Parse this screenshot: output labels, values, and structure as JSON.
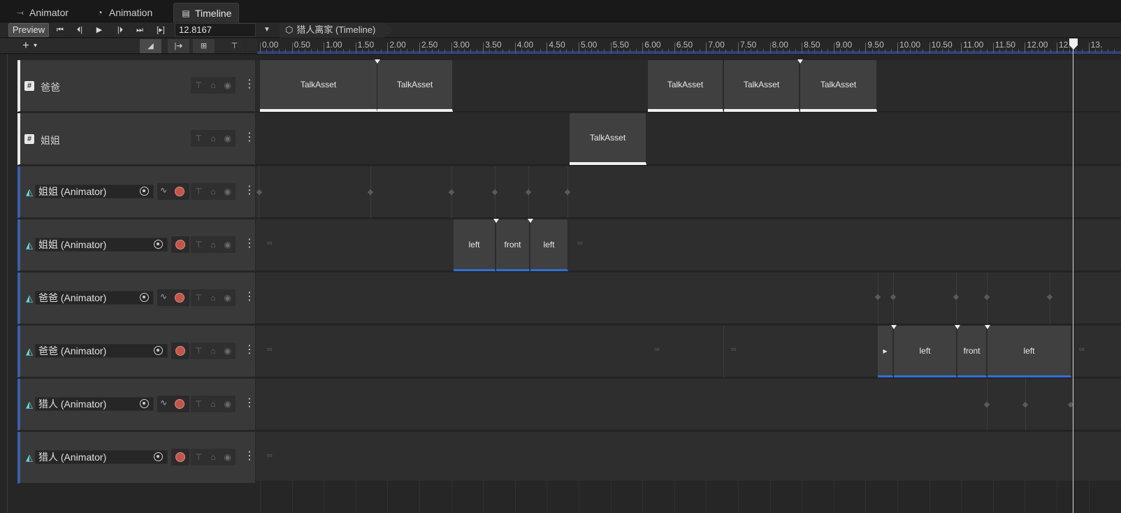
{
  "tabs": [
    {
      "label": "Animator",
      "icon": "animator-icon"
    },
    {
      "label": "Animation",
      "icon": "clock-icon"
    },
    {
      "label": "Timeline",
      "icon": "film-icon"
    }
  ],
  "toolbar": {
    "preview_label": "Preview",
    "time_value": "12.8167",
    "timeline_asset": "猎人离家 (Timeline)"
  },
  "ruler": {
    "labels": [
      "0.00",
      "0.50",
      "1.00",
      "1.50",
      "2.00",
      "2.50",
      "3.00",
      "3.50",
      "4.00",
      "4.50",
      "5.00",
      "5.50",
      "6.00",
      "6.50",
      "7.00",
      "7.50",
      "8.00",
      "8.50",
      "9.00",
      "9.50",
      "10.00",
      "10.50",
      "11.00",
      "11.50",
      "12.00",
      "12.5",
      "13."
    ]
  },
  "tracks": [
    {
      "type": "signal",
      "name": "爸爸"
    },
    {
      "type": "signal",
      "name": "姐姐"
    },
    {
      "type": "animator",
      "name": "姐姐 (Animator)",
      "infinite": true
    },
    {
      "type": "animator",
      "name": "姐姐 (Animator)",
      "infinite": false
    },
    {
      "type": "animator",
      "name": "爸爸 (Animator)",
      "infinite": true
    },
    {
      "type": "animator",
      "name": "爸爸 (Animator)",
      "infinite": false
    },
    {
      "type": "animator",
      "name": "猎人 (Animator)",
      "infinite": true
    },
    {
      "type": "animator",
      "name": "猎人 (Animator)",
      "infinite": false
    }
  ],
  "clips": {
    "talk_label": "TalkAsset",
    "left_label": "left",
    "front_label": "front"
  },
  "colors": {
    "accent_blue": "#2f6fd6",
    "record_red": "#c0564a",
    "signal_white": "#f0f0f0",
    "teal_icon": "#6ad4d4"
  }
}
